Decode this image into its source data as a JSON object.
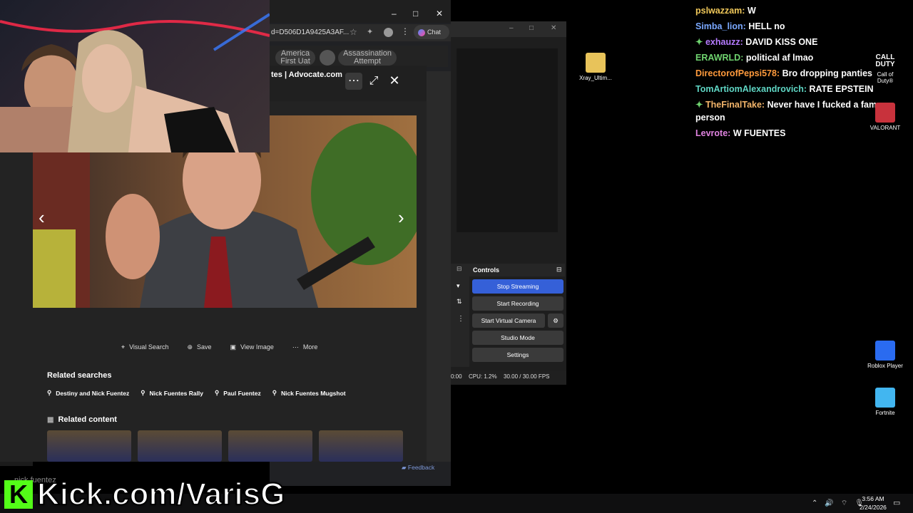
{
  "browser": {
    "url": "d=D506D1A9425A3AF...",
    "chat_button": "Chat",
    "tabs": [
      "America First Uat",
      "Assassination Attempt"
    ],
    "window_controls": {
      "minimize": "–",
      "maximize": "□",
      "close": "✕"
    }
  },
  "viewer": {
    "title": "tes | Advocate.com",
    "actions": [
      {
        "icon": "visual-search-icon",
        "label": "Visual Search"
      },
      {
        "icon": "save-icon",
        "label": "Save"
      },
      {
        "icon": "view-image-icon",
        "label": "View Image"
      },
      {
        "icon": "more-icon",
        "label": "More"
      }
    ],
    "related_searches_heading": "Related searches",
    "related_searches": [
      "Destiny and Nick Fuentez",
      "Nick Fuentes Rally",
      "Paul Fuentez",
      "Nick Fuentes Mugshot"
    ],
    "related_content_heading": "Related content",
    "feedback": "Feedback",
    "search_ghost": "nick fuentez"
  },
  "obs": {
    "controls_title": "Controls",
    "buttons": {
      "stop_streaming": "Stop Streaming",
      "start_recording": "Start Recording",
      "start_virtual_camera": "Start Virtual Camera",
      "studio_mode": "Studio Mode",
      "settings": "Settings"
    },
    "status": {
      "time": "0:00",
      "cpu": "CPU: 1.2%",
      "fps": "30.00 / 30.00 FPS"
    },
    "accent": "#3560d8"
  },
  "chat": [
    {
      "user": "pslwazzam:",
      "msg": "W",
      "color": "#f0c85a",
      "badge": false
    },
    {
      "user": "Simba_lion:",
      "msg": "HELL no",
      "color": "#7aa8ff",
      "badge": false
    },
    {
      "user": "exhauzz:",
      "msg": "DAVID KISS ONE",
      "color": "#b57bff",
      "badge": true
    },
    {
      "user": "ERAWRLD:",
      "msg": "political af lmao",
      "color": "#6fd36f",
      "badge": false
    },
    {
      "user": "DirectorofPepsi578:",
      "msg": "Bro dropping panties",
      "color": "#ff9a3c",
      "badge": false
    },
    {
      "user": "TomArtiomAlexandrovich:",
      "msg": "RATE EPSTEIN",
      "color": "#5fd6c4",
      "badge": false
    },
    {
      "user": "TheFinalTake:",
      "msg": "Never have I fucked a famous person",
      "color": "#f3b56a",
      "badge": true
    },
    {
      "user": "Levrote:",
      "msg": "W FUENTES",
      "color": "#e083e0",
      "badge": false
    }
  ],
  "desktop_icons": {
    "xray": "Xray_Ultim...",
    "cod_line1": "Call of",
    "cod_line2": "Duty®",
    "valorant": "VALORANT",
    "roblox": "Roblox Player",
    "fortnite": "Fortnite"
  },
  "overlay": {
    "kick_text": "Kick.com/VarisG",
    "kick_logo": "K"
  },
  "taskbar": {
    "time": "3:56 AM",
    "date": "2/24/2026"
  }
}
